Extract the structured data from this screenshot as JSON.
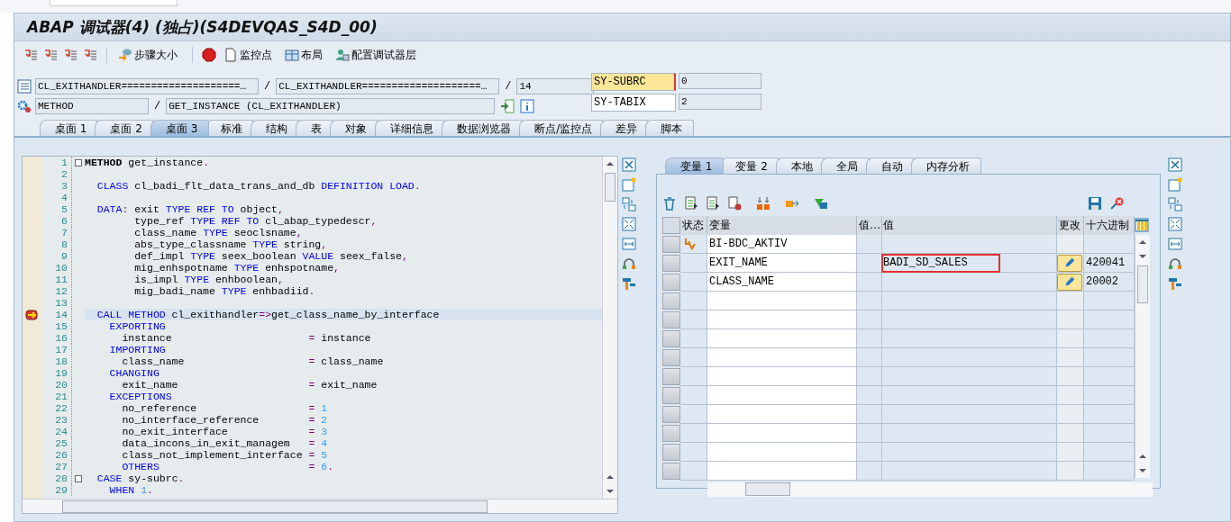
{
  "window": {
    "title": "ABAP 调试器(4) (独占)(S4DEVQAS_S4D_00)"
  },
  "toolbar": [
    {
      "label": "步骤大小"
    },
    {
      "label": "监控点"
    },
    {
      "label": "布局"
    },
    {
      "label": "配置调试器层"
    }
  ],
  "location": {
    "program": "CL_EXITHANDLER====================…",
    "include": "CL_EXITHANDLER====================…",
    "line": "14",
    "type": "METHOD",
    "name": "GET_INSTANCE (CL_EXITHANDLER)",
    "separators": [
      "/",
      "/",
      "/"
    ]
  },
  "sysvars": [
    {
      "name": "SY-SUBRC",
      "value": "0",
      "focused": true
    },
    {
      "name": "SY-TABIX",
      "value": "2",
      "focused": false
    }
  ],
  "tabs": [
    {
      "label": "桌面 1",
      "selected": false
    },
    {
      "label": "桌面 2",
      "selected": false
    },
    {
      "label": "桌面 3",
      "selected": true
    },
    {
      "label": "标准",
      "selected": false
    },
    {
      "label": "结构",
      "selected": false
    },
    {
      "label": "表",
      "selected": false
    },
    {
      "label": "对象",
      "selected": false
    },
    {
      "label": "详细信息",
      "selected": false
    },
    {
      "label": "数据浏览器",
      "selected": false
    },
    {
      "label": "断点/监控点",
      "selected": false
    },
    {
      "label": "差异",
      "selected": false
    },
    {
      "label": "脚本",
      "selected": false
    }
  ],
  "code": {
    "lines": [
      {
        "num": "1",
        "current": false,
        "fold": true,
        "segs": [
          {
            "t": "METHOD",
            "kind": "head"
          },
          {
            "t": " get_instance",
            "kind": "id"
          },
          {
            "t": ".",
            "kind": "op"
          }
        ]
      },
      {
        "num": "2",
        "current": false,
        "fold": false
      },
      {
        "num": "3",
        "current": false,
        "fold": false,
        "segs": [
          {
            "t": "  CLASS",
            "kind": "kw"
          },
          {
            "t": " cl_badi_flt_data_trans_and_db ",
            "kind": "id"
          },
          {
            "t": "DEFINITION LOAD",
            "kind": "kw"
          },
          {
            "t": ".",
            "kind": "op"
          }
        ]
      },
      {
        "num": "4",
        "current": false,
        "fold": false
      },
      {
        "num": "5",
        "current": false,
        "fold": false,
        "segs": [
          {
            "t": "  DATA",
            "kind": "kw"
          },
          {
            "t": ": ",
            "kind": "op"
          },
          {
            "t": "exit ",
            "kind": "id"
          },
          {
            "t": "TYPE REF TO",
            "kind": "kw"
          },
          {
            "t": " object",
            "kind": "id"
          },
          {
            "t": ",",
            "kind": "op"
          }
        ]
      },
      {
        "num": "6",
        "current": false,
        "fold": false,
        "segs": [
          {
            "t": "        type_ref ",
            "kind": "id"
          },
          {
            "t": "TYPE REF TO",
            "kind": "kw"
          },
          {
            "t": " cl_abap_typedescr",
            "kind": "id"
          },
          {
            "t": ",",
            "kind": "op"
          }
        ]
      },
      {
        "num": "7",
        "current": false,
        "fold": false,
        "segs": [
          {
            "t": "        class_name ",
            "kind": "id"
          },
          {
            "t": "TYPE",
            "kind": "kw"
          },
          {
            "t": " seoclsname",
            "kind": "id"
          },
          {
            "t": ",",
            "kind": "op"
          }
        ]
      },
      {
        "num": "8",
        "current": false,
        "fold": false,
        "segs": [
          {
            "t": "        abs_type_classname ",
            "kind": "id"
          },
          {
            "t": "TYPE",
            "kind": "kw"
          },
          {
            "t": " string",
            "kind": "id"
          },
          {
            "t": ",",
            "kind": "op"
          }
        ]
      },
      {
        "num": "9",
        "current": false,
        "fold": false,
        "segs": [
          {
            "t": "        def_impl ",
            "kind": "id"
          },
          {
            "t": "TYPE",
            "kind": "kw"
          },
          {
            "t": " seex_boolean ",
            "kind": "id"
          },
          {
            "t": "VALUE",
            "kind": "kw"
          },
          {
            "t": " seex_false",
            "kind": "id"
          },
          {
            "t": ",",
            "kind": "op"
          }
        ]
      },
      {
        "num": "10",
        "current": false,
        "fold": false,
        "segs": [
          {
            "t": "        mig_enhspotname ",
            "kind": "id"
          },
          {
            "t": "TYPE",
            "kind": "kw"
          },
          {
            "t": " enhspotname",
            "kind": "id"
          },
          {
            "t": ",",
            "kind": "op"
          }
        ]
      },
      {
        "num": "11",
        "current": false,
        "fold": false,
        "segs": [
          {
            "t": "        is_impl ",
            "kind": "id"
          },
          {
            "t": "TYPE",
            "kind": "kw"
          },
          {
            "t": " enhboolean",
            "kind": "id"
          },
          {
            "t": ",",
            "kind": "op"
          }
        ]
      },
      {
        "num": "12",
        "current": false,
        "fold": false,
        "segs": [
          {
            "t": "        mig_badi_name ",
            "kind": "id"
          },
          {
            "t": "TYPE",
            "kind": "kw"
          },
          {
            "t": " enhbadiid",
            "kind": "id"
          },
          {
            "t": ".",
            "kind": "op"
          }
        ]
      },
      {
        "num": "13",
        "current": false,
        "fold": false
      },
      {
        "num": "14",
        "current": true,
        "fold": false,
        "segs": [
          {
            "t": "  CALL METHOD",
            "kind": "kw"
          },
          {
            "t": " cl_exithandler",
            "kind": "id"
          },
          {
            "t": "=>",
            "kind": "op"
          },
          {
            "t": "get_class_name_by_interface",
            "kind": "id"
          }
        ]
      },
      {
        "num": "15",
        "current": false,
        "fold": false,
        "segs": [
          {
            "t": "    EXPORTING",
            "kind": "kw"
          }
        ]
      },
      {
        "num": "16",
        "current": false,
        "fold": false,
        "segs": [
          {
            "t": "      instance                      ",
            "kind": "id"
          },
          {
            "t": "= ",
            "kind": "op"
          },
          {
            "t": "instance",
            "kind": "id"
          }
        ]
      },
      {
        "num": "17",
        "current": false,
        "fold": false,
        "segs": [
          {
            "t": "    IMPORTING",
            "kind": "kw"
          }
        ]
      },
      {
        "num": "18",
        "current": false,
        "fold": false,
        "segs": [
          {
            "t": "      class_name                    ",
            "kind": "id"
          },
          {
            "t": "= ",
            "kind": "op"
          },
          {
            "t": "class_name",
            "kind": "id"
          }
        ]
      },
      {
        "num": "19",
        "current": false,
        "fold": false,
        "segs": [
          {
            "t": "    CHANGING",
            "kind": "kw"
          }
        ]
      },
      {
        "num": "20",
        "current": false,
        "fold": false,
        "segs": [
          {
            "t": "      exit_name                     ",
            "kind": "id"
          },
          {
            "t": "= ",
            "kind": "op"
          },
          {
            "t": "exit_name",
            "kind": "id"
          }
        ]
      },
      {
        "num": "21",
        "current": false,
        "fold": false,
        "segs": [
          {
            "t": "    EXCEPTIONS",
            "kind": "kw"
          }
        ]
      },
      {
        "num": "22",
        "current": false,
        "fold": false,
        "segs": [
          {
            "t": "      no_reference                  ",
            "kind": "id"
          },
          {
            "t": "= ",
            "kind": "op"
          },
          {
            "t": "1",
            "kind": "num"
          }
        ]
      },
      {
        "num": "23",
        "current": false,
        "fold": false,
        "segs": [
          {
            "t": "      no_interface_reference        ",
            "kind": "id"
          },
          {
            "t": "= ",
            "kind": "op"
          },
          {
            "t": "2",
            "kind": "num"
          }
        ]
      },
      {
        "num": "24",
        "current": false,
        "fold": false,
        "segs": [
          {
            "t": "      no_exit_interface             ",
            "kind": "id"
          },
          {
            "t": "= ",
            "kind": "op"
          },
          {
            "t": "3",
            "kind": "num"
          }
        ]
      },
      {
        "num": "25",
        "current": false,
        "fold": false,
        "segs": [
          {
            "t": "      data_incons_in_exit_managem   ",
            "kind": "id"
          },
          {
            "t": "= ",
            "kind": "op"
          },
          {
            "t": "4",
            "kind": "num"
          }
        ]
      },
      {
        "num": "26",
        "current": false,
        "fold": false,
        "segs": [
          {
            "t": "      class_not_implement_interface ",
            "kind": "id"
          },
          {
            "t": "= ",
            "kind": "op"
          },
          {
            "t": "5",
            "kind": "num"
          }
        ]
      },
      {
        "num": "27",
        "current": false,
        "fold": false,
        "segs": [
          {
            "t": "      OTHERS",
            "kind": "kw"
          },
          {
            "t": "                        = ",
            "kind": "op"
          },
          {
            "t": "6",
            "kind": "num"
          },
          {
            "t": ".",
            "kind": "op"
          }
        ]
      },
      {
        "num": "28",
        "current": false,
        "fold": true,
        "segs": [
          {
            "t": "  CASE",
            "kind": "kw"
          },
          {
            "t": " sy-subrc",
            "kind": "id"
          },
          {
            "t": ".",
            "kind": "op"
          }
        ]
      },
      {
        "num": "29",
        "current": false,
        "fold": false,
        "segs": [
          {
            "t": "    WHEN ",
            "kind": "kw"
          },
          {
            "t": "1",
            "kind": "num"
          },
          {
            "t": ".",
            "kind": "op"
          }
        ]
      }
    ]
  },
  "variables": {
    "tabs": [
      {
        "label": "变量 1",
        "selected": true
      },
      {
        "label": "变量 2",
        "selected": false
      },
      {
        "label": "本地",
        "selected": false
      },
      {
        "label": "全局",
        "selected": false
      },
      {
        "label": "自动",
        "selected": false
      },
      {
        "label": "内存分析",
        "selected": false
      }
    ],
    "columns": [
      "状态",
      "变量",
      "值…",
      "值",
      "更改",
      "十六进制"
    ],
    "rows": [
      {
        "variable": "BI-BDC_AKTIV",
        "flagged": true,
        "highlighted": false,
        "editable": false
      },
      {
        "variable": "EXIT_NAME",
        "flagged": false,
        "value": "BADI_SD_SALES",
        "highlighted": true,
        "editable": true,
        "hex": "420041"
      },
      {
        "variable": "CLASS_NAME",
        "flagged": false,
        "highlighted": false,
        "editable": true,
        "hex": "20002"
      }
    ]
  }
}
